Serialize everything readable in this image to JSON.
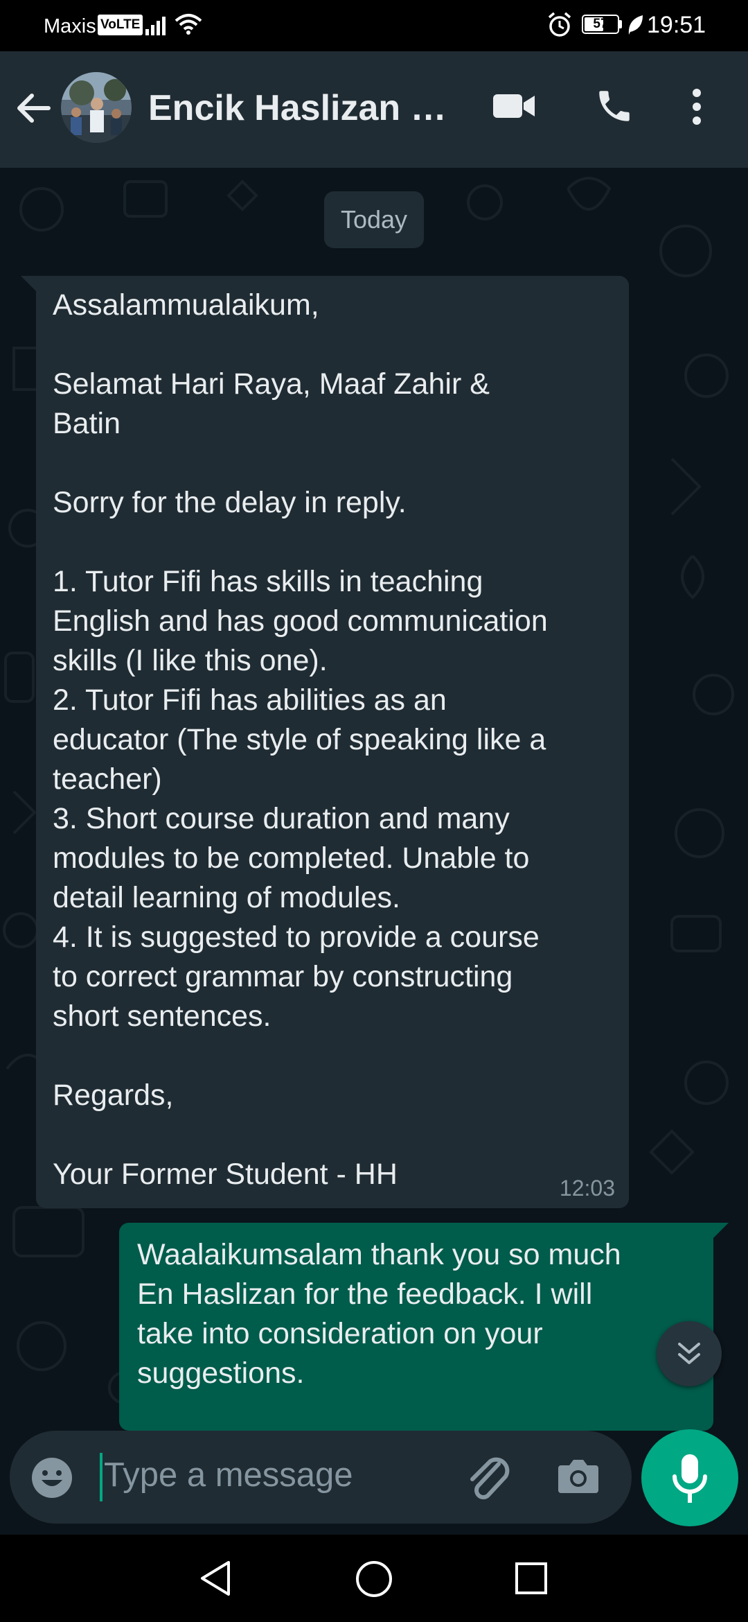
{
  "status_bar": {
    "carrier": "Maxis",
    "volte": "VoLTE",
    "battery_level": "57",
    "time": "19:51"
  },
  "header": {
    "contact_name": "Encik Haslizan E...",
    "icons": [
      "back-arrow-icon",
      "video-call-icon",
      "voice-call-icon",
      "more-options-icon"
    ]
  },
  "chat": {
    "date_chip": "Today",
    "incoming": {
      "lines": [
        "Assalammualaikum,",
        "",
        "Selamat Hari Raya, Maaf Zahir &",
        "Batin",
        "",
        "Sorry for the delay in reply.",
        "",
        "1. Tutor Fifi has skills in teaching",
        "English and has good communication",
        "skills (I like this one).",
        "2. Tutor Fifi has abilities as an",
        "educator (The style of speaking like a",
        "teacher)",
        "3. Short course duration and many",
        "modules to be completed. Unable to",
        "detail learning of modules.",
        "4. It is suggested to provide a course",
        "to correct grammar by constructing",
        "short sentences.",
        "",
        "Regards,",
        "",
        "Your Former Student - HH"
      ],
      "time": "12:03"
    },
    "outgoing": {
      "lines": [
        "Waalaikumsalam thank you so much",
        "En Haslizan for the feedback. I will",
        "take into consideration on your",
        "suggestions."
      ]
    }
  },
  "input": {
    "placeholder": "Type a message"
  },
  "colors": {
    "header_bg": "#202c33",
    "chat_bg": "#0b141a",
    "incoming_bubble": "#202c33",
    "outgoing_bubble": "#005c4b",
    "accent": "#00a884",
    "text_primary": "#e9edef",
    "text_secondary": "#8696a0"
  }
}
